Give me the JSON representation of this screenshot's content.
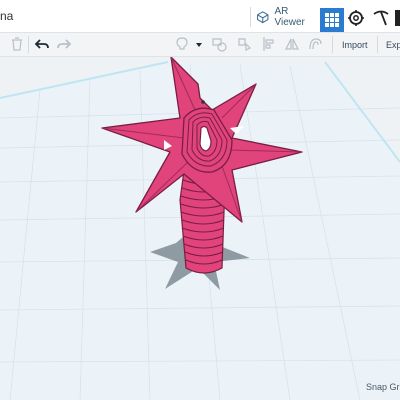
{
  "header": {
    "title_fragment": "na",
    "ar_viewer_label": "AR Viewer",
    "grid_view_icon": "grid-icon",
    "engine_icon": "gear-hand-icon",
    "build_icon": "pickaxe-icon"
  },
  "toolbar": {
    "import_label": "Import",
    "export_label": "Expo",
    "tools": [
      "trash-icon",
      "undo-icon",
      "redo-icon",
      "light-bulb-icon",
      "dropdown-icon",
      "shape-group-icon",
      "ungroup-icon",
      "align-icon",
      "mirror-icon",
      "workplane-icon"
    ]
  },
  "status": {
    "snap_grid_label": "Snap Grid"
  },
  "colors": {
    "accent": "#2b7bd1",
    "model": "#e0447a",
    "model_outline": "#7a1d45",
    "workplane": "#e9f1f6",
    "grid_line": "#d3e0ea"
  }
}
